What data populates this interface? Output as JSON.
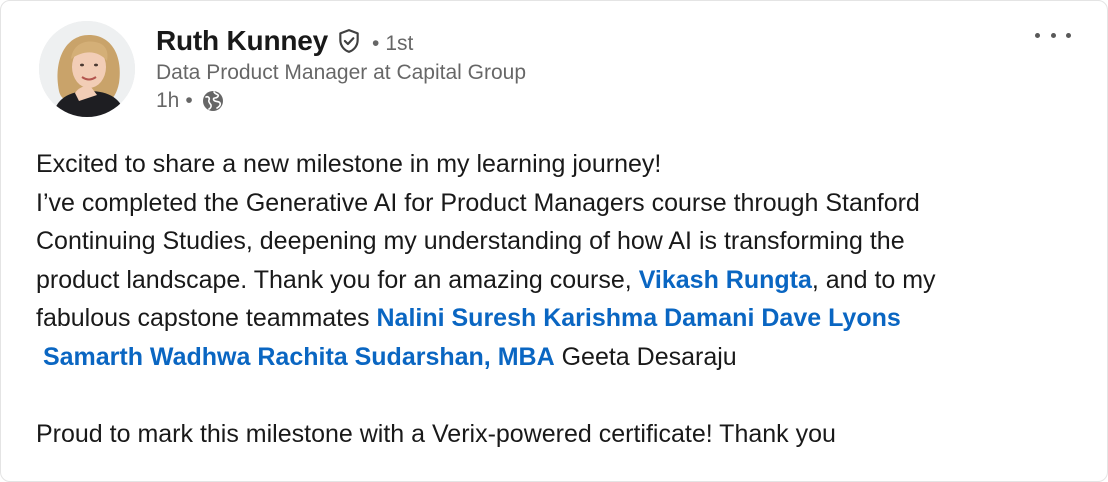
{
  "author": {
    "name": "Ruth Kunney",
    "degree": "1st",
    "headline": "Data Product Manager at Capital Group",
    "time": "1h",
    "verified_icon": "shield-check-icon",
    "visibility_icon": "globe-icon"
  },
  "menu": {
    "icon": "ellipsis-icon"
  },
  "post": {
    "line1": "Excited to share a new milestone in my learning journey!",
    "line2": "I’ve completed the Generative AI for Product Managers course through Stanford",
    "line3": "Continuing Studies, deepening my understanding of how AI is transforming the",
    "line4_pre": "product landscape. Thank you for an amazing course, ",
    "line4_mention": "Vikash Rungta",
    "line4_post": ", and to my",
    "line5_pre": "fabulous capstone teammates ",
    "mentions_line5": [
      "Nalini Suresh",
      "Karishma Damani",
      "Dave Lyons"
    ],
    "mentions_line6": [
      "Samarth Wadhwa",
      "Rachita Sudarshan, MBA"
    ],
    "line6_post": "Geeta Desaraju",
    "line7": "Proud to mark this milestone with a Verix-powered certificate! Thank you"
  },
  "colors": {
    "link": "#0a66c2",
    "text": "#1a1a1a",
    "muted": "#666666"
  }
}
